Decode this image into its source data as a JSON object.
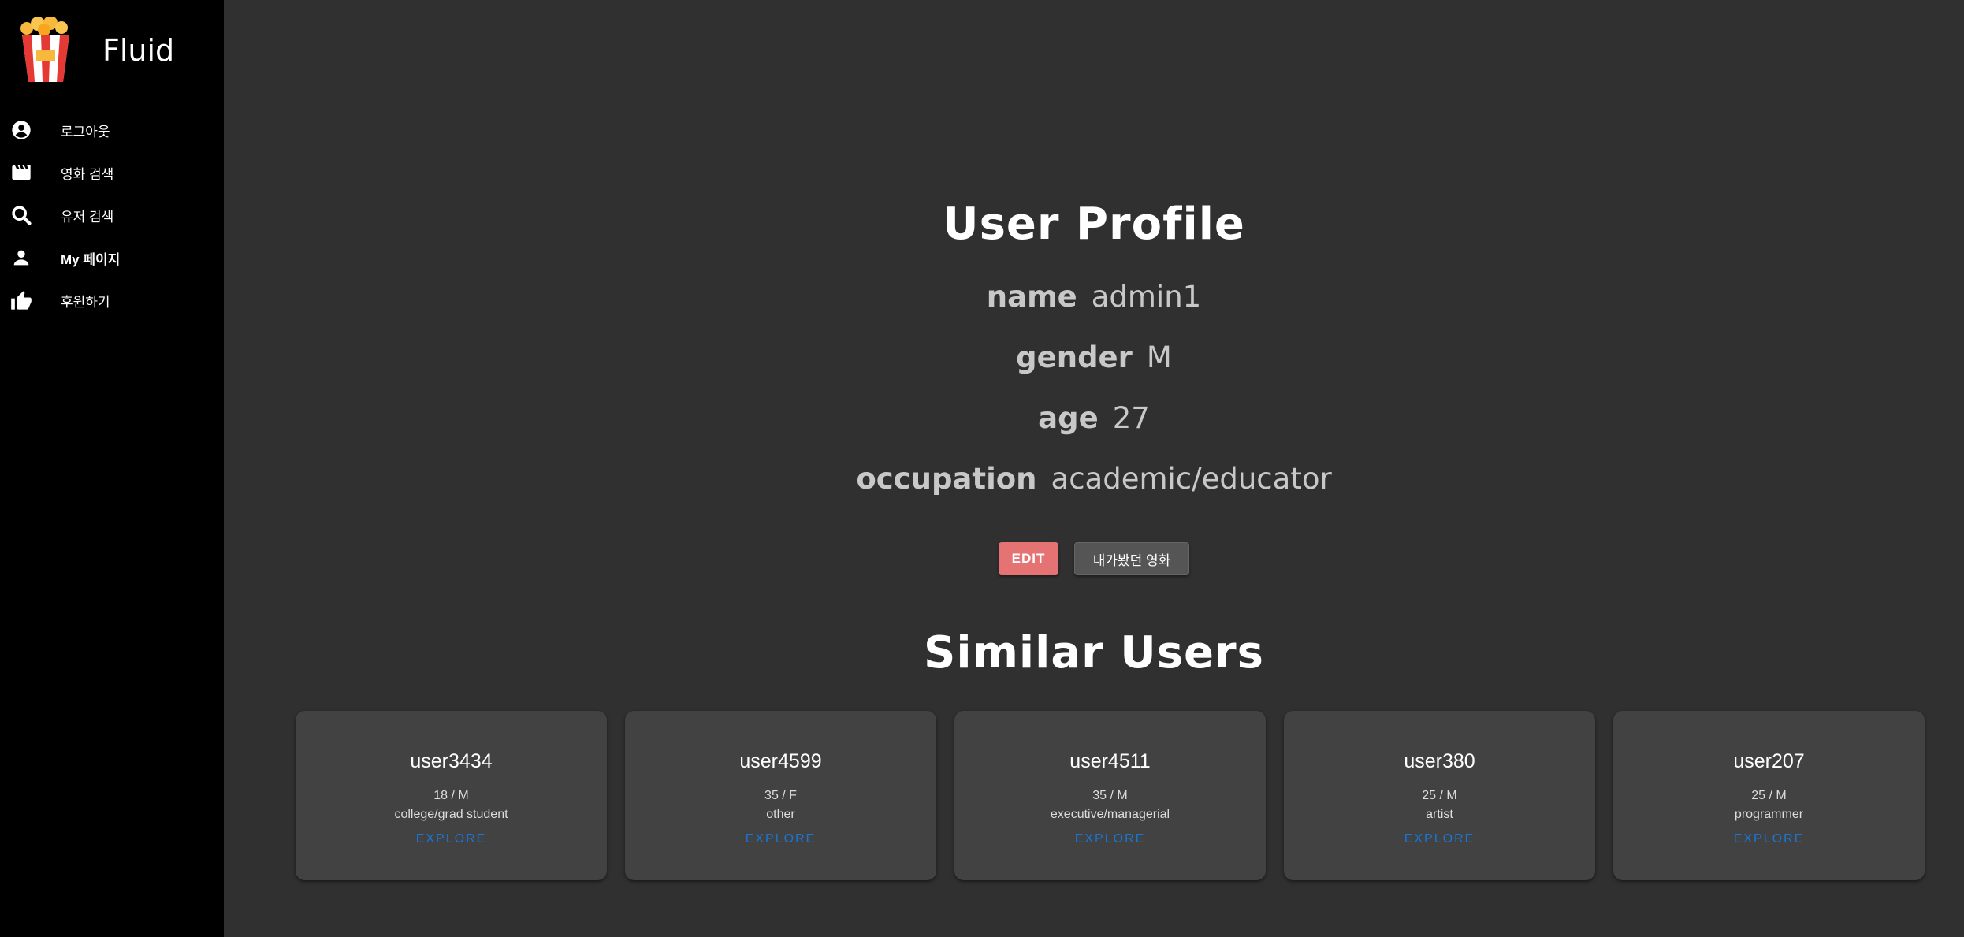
{
  "sidebar": {
    "brand": "Fluid",
    "items": [
      {
        "label": "로그아웃",
        "icon": "account-circle-icon"
      },
      {
        "label": "영화 검색",
        "icon": "movie-icon"
      },
      {
        "label": "유저 검색",
        "icon": "search-icon"
      },
      {
        "label": "My 페이지",
        "icon": "person-icon"
      },
      {
        "label": "후원하기",
        "icon": "thumb-up-icon"
      }
    ]
  },
  "profile": {
    "title": "User Profile",
    "fields": [
      {
        "key": "name",
        "value": "admin1"
      },
      {
        "key": "gender",
        "value": "M"
      },
      {
        "key": "age",
        "value": "27"
      },
      {
        "key": "occupation",
        "value": "academic/educator"
      }
    ],
    "edit_label": "EDIT",
    "watched_label": "내가봤던 영화"
  },
  "similar": {
    "title": "Similar Users",
    "users": [
      {
        "name": "user3434",
        "meta": "18 / M",
        "occupation": "college/grad student",
        "action": "EXPLORE"
      },
      {
        "name": "user4599",
        "meta": "35 / F",
        "occupation": "other",
        "action": "EXPLORE"
      },
      {
        "name": "user4511",
        "meta": "35 / M",
        "occupation": "executive/managerial",
        "action": "EXPLORE"
      },
      {
        "name": "user380",
        "meta": "25 / M",
        "occupation": "artist",
        "action": "EXPLORE"
      },
      {
        "name": "user207",
        "meta": "25 / M",
        "occupation": "programmer",
        "action": "EXPLORE"
      }
    ]
  },
  "colors": {
    "sidebar_bg": "#000000",
    "main_bg": "#303030",
    "card_bg": "#424242",
    "edit_button": "#e57373",
    "explore_link": "#1976d2"
  }
}
